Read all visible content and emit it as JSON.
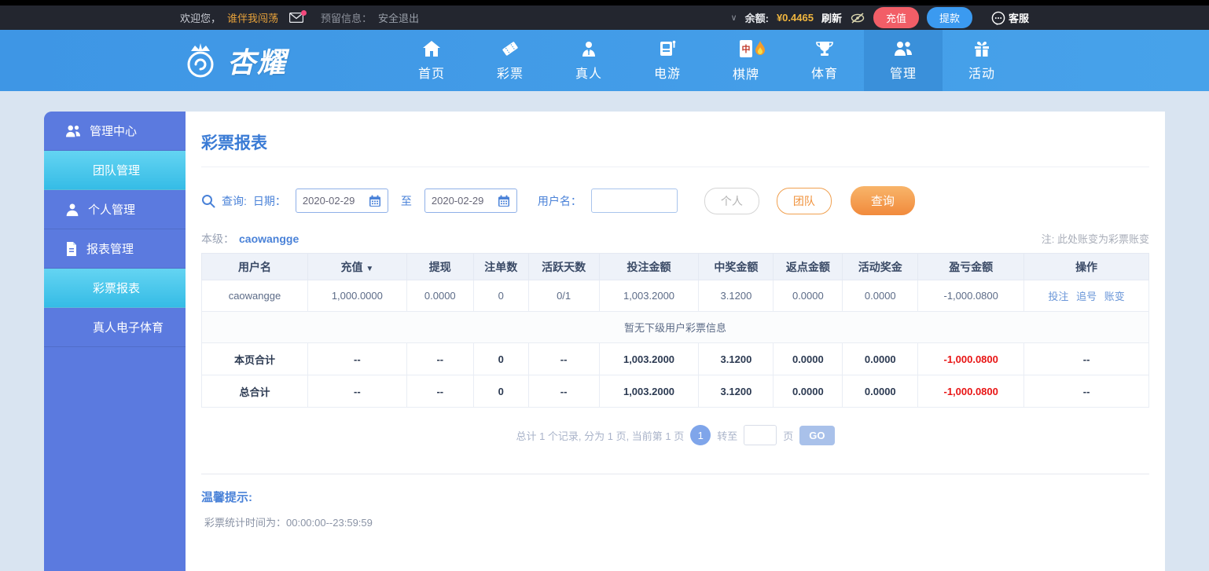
{
  "topbar": {
    "welcome_prefix": "欢迎您，",
    "username": "谁伴我闯荡",
    "message_label": "预留信息：",
    "logout": "安全退出",
    "chevron": "∨",
    "balance_label": "余额:",
    "balance_value": "¥0.4465",
    "refresh": "刷新",
    "recharge": "充值",
    "withdraw": "提款",
    "service": "客服"
  },
  "nav": {
    "logo_text": "杏耀",
    "items": [
      {
        "label": "首页",
        "icon": "home-icon",
        "active": false
      },
      {
        "label": "彩票",
        "icon": "ticket-icon",
        "active": false
      },
      {
        "label": "真人",
        "icon": "live-person-icon",
        "active": false
      },
      {
        "label": "电游",
        "icon": "slot-machine-icon",
        "active": false
      },
      {
        "label": "棋牌",
        "icon": "mahjong-tile-icon",
        "active": false,
        "hot": true
      },
      {
        "label": "体育",
        "icon": "trophy-icon",
        "active": false
      },
      {
        "label": "管理",
        "icon": "users-icon",
        "active": true
      },
      {
        "label": "活动",
        "icon": "gift-icon",
        "active": false
      }
    ]
  },
  "sidebar": {
    "items": [
      {
        "label": "管理中心",
        "icon": "users-icon",
        "level": "parent",
        "highlight": false
      },
      {
        "label": "团队管理",
        "icon": null,
        "level": "sub",
        "highlight": true
      },
      {
        "label": "个人管理",
        "icon": "user-icon",
        "level": "parent",
        "highlight": false
      },
      {
        "label": "报表管理",
        "icon": "document-icon",
        "level": "parent",
        "highlight": false
      },
      {
        "label": "彩票报表",
        "icon": null,
        "level": "sub",
        "highlight": true
      },
      {
        "label": "真人电子体育",
        "icon": null,
        "level": "sub",
        "highlight": false
      }
    ]
  },
  "main": {
    "title": "彩票报表",
    "search": {
      "query_label": "查询:",
      "date_label": "日期：",
      "date_from": "2020-02-29",
      "to_label": "至",
      "date_to": "2020-02-29",
      "username_label": "用户名：",
      "username_value": "",
      "btn_personal": "个人",
      "btn_team": "团队",
      "btn_search": "查询"
    },
    "level_label": "本级：",
    "level_user": "caowangge",
    "note": "注: 此处账变为彩票账变",
    "table": {
      "headers": [
        "用户名",
        "充值",
        "提现",
        "注单数",
        "活跃天数",
        "投注金额",
        "中奖金额",
        "返点金额",
        "活动奖金",
        "盈亏金额",
        "操作"
      ],
      "sort_arrow": "▼",
      "row": {
        "username": "caowangge",
        "recharge": "1,000.0000",
        "withdraw": "0.0000",
        "orders": "0",
        "active_days": "0/1",
        "bet_amount": "1,003.2000",
        "win_amount": "3.1200",
        "rebate_amount": "0.0000",
        "activity_bonus": "0.0000",
        "profit": "-1,000.0800",
        "actions": [
          "投注",
          "追号",
          "账变"
        ]
      },
      "empty_message": "暂无下级用户彩票信息",
      "page_total": [
        "本页合计",
        "--",
        "--",
        "0",
        "--",
        "1,003.2000",
        "3.1200",
        "0.0000",
        "0.0000",
        "-1,000.0800",
        "--"
      ],
      "grand_total": [
        "总合计",
        "--",
        "--",
        "0",
        "--",
        "1,003.2000",
        "3.1200",
        "0.0000",
        "0.0000",
        "-1,000.0800",
        "--"
      ]
    },
    "pagination": {
      "summary": "总计 1 个记录, 分为 1 页, 当前第 1 页",
      "current_page": "1",
      "goto_label": "转至",
      "page_unit": "页",
      "go_button": "GO"
    },
    "tips": {
      "title": "温馨提示:",
      "line": "彩票统计时间为：00:00:00--23:59:59"
    }
  },
  "colors": {
    "accent_blue": "#3a7bd5",
    "nav_blue": "#419ce8",
    "sidebar_purple_blue": "#5b7adf",
    "sidebar_cyan": "#3fc3ea",
    "loss_red": "#e83f3f",
    "recharge_red": "#f25e67",
    "withdraw_blue": "#3b9af0",
    "orange_button": "#f18a3c",
    "balance_yellow": "#f0b63f"
  }
}
